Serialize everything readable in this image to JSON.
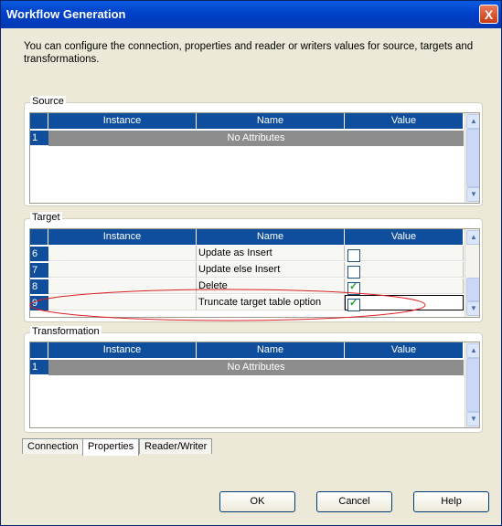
{
  "window": {
    "title": "Workflow Generation",
    "close_label": "X"
  },
  "intro": "You can configure the connection, properties and reader or writers values for source, targets and transformations.",
  "columns": {
    "instance": "Instance",
    "name": "Name",
    "value": "Value"
  },
  "source": {
    "label": "Source",
    "rows": [
      {
        "num": "1",
        "text": "No Attributes"
      }
    ]
  },
  "target": {
    "label": "Target",
    "rows": [
      {
        "num": "6",
        "name": "Update as Insert",
        "checked": false
      },
      {
        "num": "7",
        "name": "Update else Insert",
        "checked": false
      },
      {
        "num": "8",
        "name": "Delete",
        "checked": true
      },
      {
        "num": "9",
        "name": "Truncate target table option",
        "checked": true
      }
    ]
  },
  "transformation": {
    "label": "Transformation",
    "rows": [
      {
        "num": "1",
        "text": "No Attributes"
      }
    ]
  },
  "tabs": [
    "Connection",
    "Properties",
    "Reader/Writer"
  ],
  "active_tab": "Properties",
  "buttons": {
    "ok": "OK",
    "cancel": "Cancel",
    "help": "Help"
  },
  "colors": {
    "header": "#0e4e9c",
    "highlight_ellipse": "#d92020",
    "titlebar": "#0041c8"
  }
}
